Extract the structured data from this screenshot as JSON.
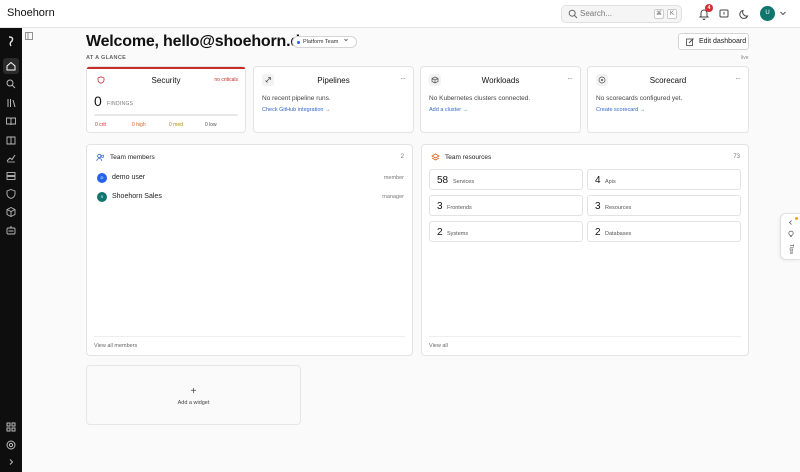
{
  "app": {
    "title": "Shoehorn"
  },
  "search": {
    "placeholder": "Search...",
    "key1": "⌘",
    "key2": "K"
  },
  "notifications": {
    "count": "4"
  },
  "user": {
    "avatar_initial": "U"
  },
  "header": {
    "welcome": "Welcome, hello@shoehorn.dev",
    "team_selector": "Platform Team",
    "edit_button": "Edit dashboard",
    "section_label": "AT A GLANCE",
    "live_label": "live"
  },
  "cards": {
    "security": {
      "title": "Security",
      "status": "no criticals",
      "findings_count": "0",
      "findings_label": "FINDINGS",
      "crit": "0 crit",
      "high": "0 high",
      "med": "0 med",
      "low": "0 low"
    },
    "pipelines": {
      "title": "Pipelines",
      "text": "No recent pipeline runs.",
      "link": "Check GitHub integration →"
    },
    "workloads": {
      "title": "Workloads",
      "text": "No Kubernetes clusters connected.",
      "link": "Add a cluster →"
    },
    "scorecard": {
      "title": "Scorecard",
      "text": "No scorecards configured yet.",
      "link": "Create scorecard →"
    }
  },
  "team_members": {
    "title": "Team members",
    "count": "2",
    "members": [
      {
        "name": "demo user",
        "role": "member",
        "initial": "D",
        "color": "#2563eb"
      },
      {
        "name": "Shoehorn Sales",
        "role": "manager",
        "initial": "S",
        "color": "#0f766e"
      }
    ],
    "footer_link": "View all members"
  },
  "team_resources": {
    "title": "Team resources",
    "count": "73",
    "items": [
      {
        "count": "58",
        "label": "Services"
      },
      {
        "count": "4",
        "label": "Apis"
      },
      {
        "count": "3",
        "label": "Frontends"
      },
      {
        "count": "3",
        "label": "Resources"
      },
      {
        "count": "2",
        "label": "Systems"
      },
      {
        "count": "2",
        "label": "Databases"
      }
    ],
    "footer_link": "View all"
  },
  "widget": {
    "plus": "+",
    "label": "Add a widget"
  },
  "tips": {
    "label": "Tips"
  },
  "more_icon": "···",
  "colors": {
    "accent": "#2563eb",
    "danger": "#c92a2a",
    "brand_avatar": "#0f766e",
    "sidebar": "#0e0e0e"
  }
}
